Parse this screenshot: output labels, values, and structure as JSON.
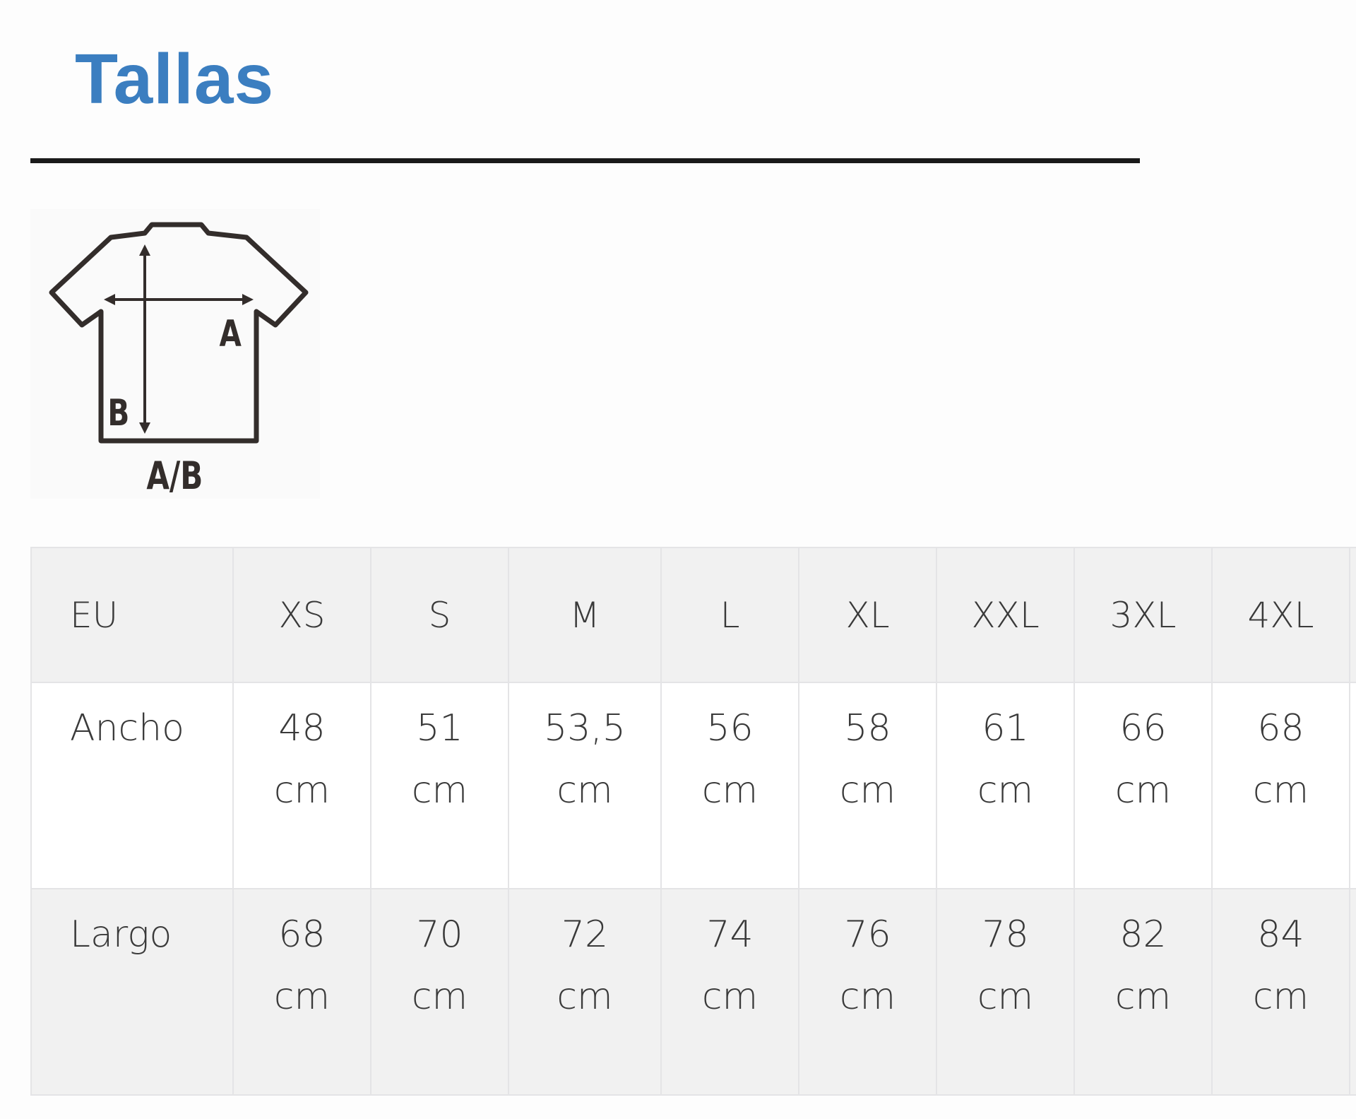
{
  "page": {
    "title": "Tallas"
  },
  "diagram": {
    "icon": "t-shirt-measurement-icon",
    "label_width": "A",
    "label_length": "B",
    "label_combined": "A/B"
  },
  "table": {
    "header": [
      "EU",
      "XS",
      "S",
      "M",
      "L",
      "XL",
      "XXL",
      "3XL",
      "4XL"
    ],
    "rows": [
      {
        "label": "Ancho",
        "values": [
          [
            "48",
            "cm"
          ],
          [
            "51",
            "cm"
          ],
          [
            "53,5",
            "cm"
          ],
          [
            "56",
            "cm"
          ],
          [
            "58",
            "cm"
          ],
          [
            "61",
            "cm"
          ],
          [
            "66",
            "cm"
          ],
          [
            "68",
            "cm"
          ]
        ]
      },
      {
        "label": "Largo",
        "values": [
          [
            "68",
            "cm"
          ],
          [
            "70",
            "cm"
          ],
          [
            "72",
            "cm"
          ],
          [
            "74",
            "cm"
          ],
          [
            "76",
            "cm"
          ],
          [
            "78",
            "cm"
          ],
          [
            "82",
            "cm"
          ],
          [
            "84",
            "cm"
          ]
        ]
      }
    ]
  },
  "colors": {
    "title": "#3b7ec0",
    "divider": "#1a1a1a",
    "stripe": "#f1f1f1",
    "border": "#e4e4e6",
    "text": "#3a3a3a"
  }
}
